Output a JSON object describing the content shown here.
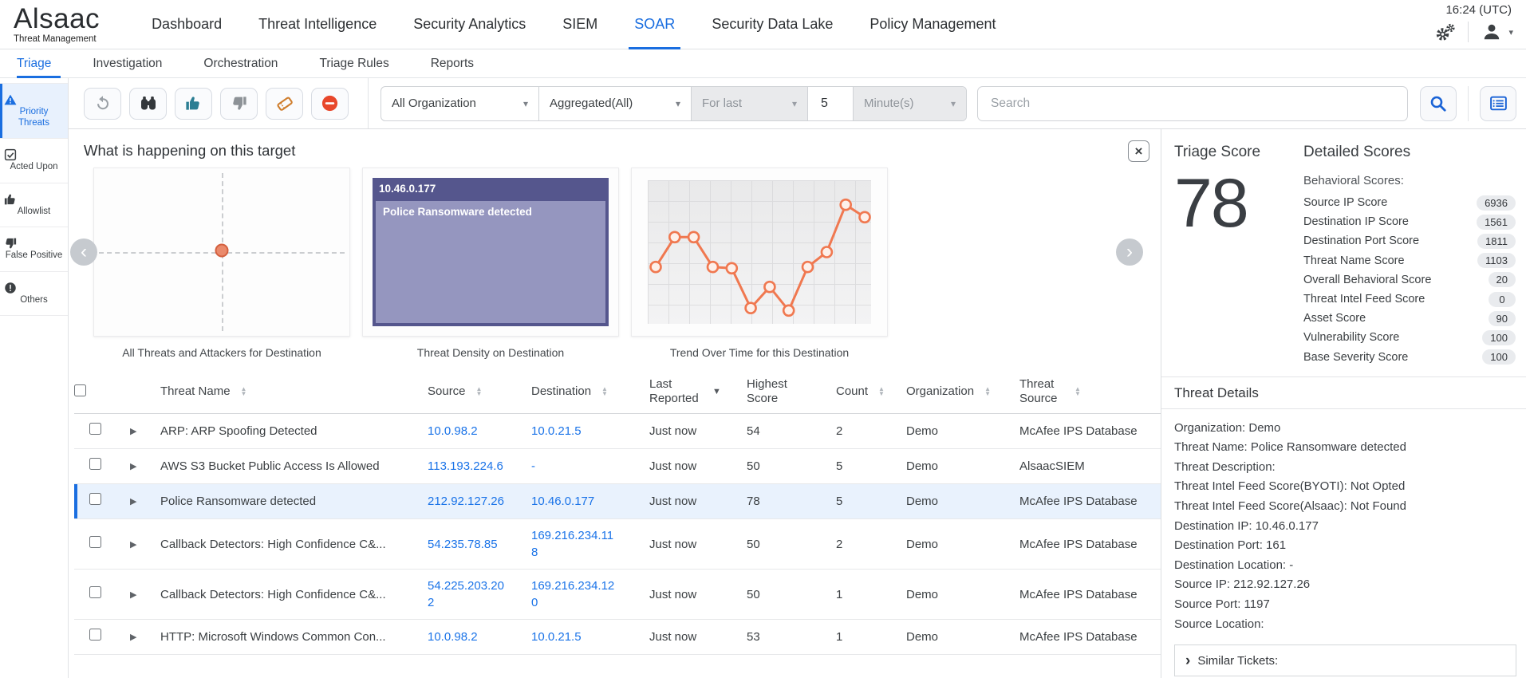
{
  "header": {
    "brand": "Alsaac",
    "brand_sub": "Threat Management",
    "time": "16:24 (UTC)",
    "nav_items": [
      "Dashboard",
      "Threat Intelligence",
      "Security Analytics",
      "SIEM",
      "SOAR",
      "Security Data Lake",
      "Policy Management"
    ],
    "active_item": "SOAR",
    "icons": [
      "settings-gears-icon",
      "user-icon"
    ]
  },
  "subnav": {
    "items": [
      "Triage",
      "Investigation",
      "Orchestration",
      "Triage Rules",
      "Reports"
    ],
    "active_item": "Triage"
  },
  "sidebar": {
    "items": [
      {
        "label": "Priority Threats",
        "icon": "warning-triangle-icon",
        "active": true
      },
      {
        "label": "Acted Upon",
        "icon": "checked-box-icon",
        "active": false
      },
      {
        "label": "Allowlist",
        "icon": "thumb-up-icon",
        "active": false
      },
      {
        "label": "False Positive",
        "icon": "thumb-down-icon",
        "active": false
      },
      {
        "label": "Others",
        "icon": "exclamation-circle-icon",
        "active": false
      }
    ]
  },
  "toolbar": {
    "action_icons": [
      "refresh-icon",
      "binoculars-icon",
      "thumb-up-icon",
      "thumb-down-icon",
      "ticket-icon",
      "block-icon"
    ],
    "org_filter": "All Organization",
    "aggregation_filter": "Aggregated(All)",
    "range_label": "For last",
    "range_value": "5",
    "range_unit": "Minute(s)",
    "search_placeholder": "Search",
    "accent_color": "#1a6ee0"
  },
  "carousel": {
    "title": "What is happening on this target"
  },
  "chart_data": [
    {
      "type": "scatter",
      "title": "All Threats and Attackers for Destination",
      "points": [
        {
          "x": 0.5,
          "y": 0.49
        }
      ],
      "marker_color": "#ea8a6c",
      "crosshair": true
    },
    {
      "type": "treemap",
      "title": "Threat Density on Destination",
      "nodes": [
        {
          "label": "10.46.0.177",
          "children": [
            {
              "label": "Police Ransomware detected"
            }
          ]
        }
      ],
      "outer_color": "#55568d",
      "inner_color": "#9596bf"
    },
    {
      "type": "line",
      "title": "Trend Over Time for this Destination",
      "x": [
        1,
        2,
        3,
        4,
        5,
        6,
        7,
        8,
        9,
        10,
        11,
        12
      ],
      "values": [
        38,
        62,
        62,
        38,
        37,
        5,
        22,
        3,
        38,
        50,
        88,
        78
      ],
      "ylim": [
        0,
        100
      ],
      "line_color": "#f07850",
      "marker_fill": "#fdf0ea",
      "grid": true
    }
  ],
  "table": {
    "columns": [
      "Threat Name",
      "Source",
      "Destination",
      "Last Reported",
      "Highest Score",
      "Count",
      "Organization",
      "Threat Source"
    ],
    "sort_column": "Last Reported",
    "sort_direction": "desc",
    "rows": [
      {
        "name": "ARP: ARP Spoofing Detected",
        "source": "10.0.98.2",
        "destination": "10.0.21.5",
        "last_reported": "Just now",
        "highest_score": "54",
        "count": "2",
        "organization": "Demo",
        "threat_source": "McAfee IPS Database",
        "selected": false
      },
      {
        "name": "AWS S3 Bucket Public Access Is Allowed",
        "source": "113.193.224.6",
        "destination": "-",
        "last_reported": "Just now",
        "highest_score": "50",
        "count": "5",
        "organization": "Demo",
        "threat_source": "AlsaacSIEM",
        "selected": false
      },
      {
        "name": "Police Ransomware detected",
        "source": "212.92.127.26",
        "destination": "10.46.0.177",
        "last_reported": "Just now",
        "highest_score": "78",
        "count": "5",
        "organization": "Demo",
        "threat_source": "McAfee IPS Database",
        "selected": true
      },
      {
        "name": "Callback Detectors: High Confidence C&...",
        "source": "54.235.78.85",
        "destination": "169.216.234.118",
        "last_reported": "Just now",
        "highest_score": "50",
        "count": "2",
        "organization": "Demo",
        "threat_source": "McAfee IPS Database",
        "selected": false
      },
      {
        "name": "Callback Detectors: High Confidence C&...",
        "source": "54.225.203.202",
        "destination": "169.216.234.120",
        "last_reported": "Just now",
        "highest_score": "50",
        "count": "1",
        "organization": "Demo",
        "threat_source": "McAfee IPS Database",
        "selected": false
      },
      {
        "name": "HTTP: Microsoft Windows Common Con...",
        "source": "10.0.98.2",
        "destination": "10.0.21.5",
        "last_reported": "Just now",
        "highest_score": "53",
        "count": "1",
        "organization": "Demo",
        "threat_source": "McAfee IPS Database",
        "selected": false
      }
    ]
  },
  "score_panel": {
    "title": "Triage Score",
    "score": "78",
    "detailed_title": "Detailed Scores",
    "group_label": "Behavioral Scores:",
    "scores": [
      {
        "label": "Source IP Score",
        "value": "6936"
      },
      {
        "label": "Destination IP Score",
        "value": "1561"
      },
      {
        "label": "Destination Port Score",
        "value": "1811"
      },
      {
        "label": "Threat Name Score",
        "value": "1103"
      },
      {
        "label": "Overall Behavioral Score",
        "value": "20"
      },
      {
        "label": "Threat Intel Feed Score",
        "value": "0"
      },
      {
        "label": "Asset Score",
        "value": "90"
      },
      {
        "label": "Vulnerability Score",
        "value": "100"
      },
      {
        "label": "Base Severity Score",
        "value": "100"
      }
    ]
  },
  "threat_details": {
    "title": "Threat Details",
    "lines": [
      "Organization: Demo",
      "Threat Name: Police Ransomware detected",
      "Threat Description:",
      "Threat Intel Feed Score(BYOTI): Not Opted",
      "Threat Intel Feed Score(Alsaac): Not Found",
      "Destination IP: 10.46.0.177",
      "Destination Port: 161",
      "Destination Location: -",
      "Source IP: 212.92.127.26",
      "Source Port: 1197",
      "Source Location:"
    ],
    "similar_label": "Similar Tickets:"
  }
}
